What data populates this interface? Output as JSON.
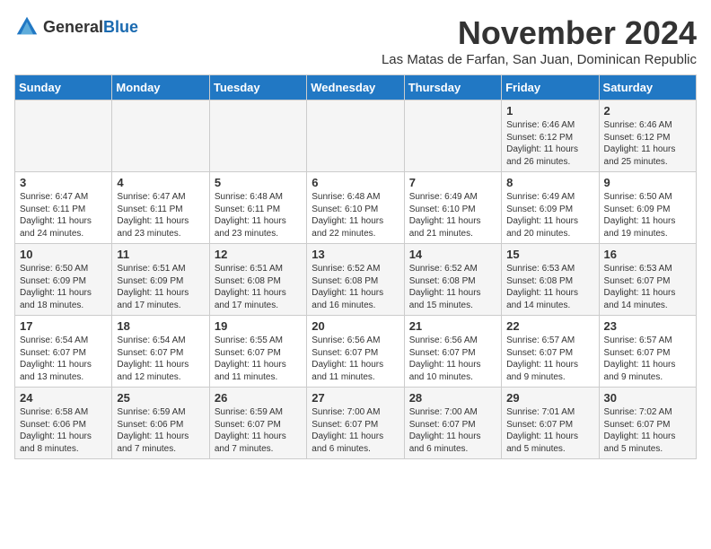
{
  "logo": {
    "general": "General",
    "blue": "Blue"
  },
  "title": "November 2024",
  "subtitle": "Las Matas de Farfan, San Juan, Dominican Republic",
  "days_of_week": [
    "Sunday",
    "Monday",
    "Tuesday",
    "Wednesday",
    "Thursday",
    "Friday",
    "Saturday"
  ],
  "weeks": [
    [
      {
        "day": "",
        "info": ""
      },
      {
        "day": "",
        "info": ""
      },
      {
        "day": "",
        "info": ""
      },
      {
        "day": "",
        "info": ""
      },
      {
        "day": "",
        "info": ""
      },
      {
        "day": "1",
        "info": "Sunrise: 6:46 AM\nSunset: 6:12 PM\nDaylight: 11 hours and 26 minutes."
      },
      {
        "day": "2",
        "info": "Sunrise: 6:46 AM\nSunset: 6:12 PM\nDaylight: 11 hours and 25 minutes."
      }
    ],
    [
      {
        "day": "3",
        "info": "Sunrise: 6:47 AM\nSunset: 6:11 PM\nDaylight: 11 hours and 24 minutes."
      },
      {
        "day": "4",
        "info": "Sunrise: 6:47 AM\nSunset: 6:11 PM\nDaylight: 11 hours and 23 minutes."
      },
      {
        "day": "5",
        "info": "Sunrise: 6:48 AM\nSunset: 6:11 PM\nDaylight: 11 hours and 23 minutes."
      },
      {
        "day": "6",
        "info": "Sunrise: 6:48 AM\nSunset: 6:10 PM\nDaylight: 11 hours and 22 minutes."
      },
      {
        "day": "7",
        "info": "Sunrise: 6:49 AM\nSunset: 6:10 PM\nDaylight: 11 hours and 21 minutes."
      },
      {
        "day": "8",
        "info": "Sunrise: 6:49 AM\nSunset: 6:09 PM\nDaylight: 11 hours and 20 minutes."
      },
      {
        "day": "9",
        "info": "Sunrise: 6:50 AM\nSunset: 6:09 PM\nDaylight: 11 hours and 19 minutes."
      }
    ],
    [
      {
        "day": "10",
        "info": "Sunrise: 6:50 AM\nSunset: 6:09 PM\nDaylight: 11 hours and 18 minutes."
      },
      {
        "day": "11",
        "info": "Sunrise: 6:51 AM\nSunset: 6:09 PM\nDaylight: 11 hours and 17 minutes."
      },
      {
        "day": "12",
        "info": "Sunrise: 6:51 AM\nSunset: 6:08 PM\nDaylight: 11 hours and 17 minutes."
      },
      {
        "day": "13",
        "info": "Sunrise: 6:52 AM\nSunset: 6:08 PM\nDaylight: 11 hours and 16 minutes."
      },
      {
        "day": "14",
        "info": "Sunrise: 6:52 AM\nSunset: 6:08 PM\nDaylight: 11 hours and 15 minutes."
      },
      {
        "day": "15",
        "info": "Sunrise: 6:53 AM\nSunset: 6:08 PM\nDaylight: 11 hours and 14 minutes."
      },
      {
        "day": "16",
        "info": "Sunrise: 6:53 AM\nSunset: 6:07 PM\nDaylight: 11 hours and 14 minutes."
      }
    ],
    [
      {
        "day": "17",
        "info": "Sunrise: 6:54 AM\nSunset: 6:07 PM\nDaylight: 11 hours and 13 minutes."
      },
      {
        "day": "18",
        "info": "Sunrise: 6:54 AM\nSunset: 6:07 PM\nDaylight: 11 hours and 12 minutes."
      },
      {
        "day": "19",
        "info": "Sunrise: 6:55 AM\nSunset: 6:07 PM\nDaylight: 11 hours and 11 minutes."
      },
      {
        "day": "20",
        "info": "Sunrise: 6:56 AM\nSunset: 6:07 PM\nDaylight: 11 hours and 11 minutes."
      },
      {
        "day": "21",
        "info": "Sunrise: 6:56 AM\nSunset: 6:07 PM\nDaylight: 11 hours and 10 minutes."
      },
      {
        "day": "22",
        "info": "Sunrise: 6:57 AM\nSunset: 6:07 PM\nDaylight: 11 hours and 9 minutes."
      },
      {
        "day": "23",
        "info": "Sunrise: 6:57 AM\nSunset: 6:07 PM\nDaylight: 11 hours and 9 minutes."
      }
    ],
    [
      {
        "day": "24",
        "info": "Sunrise: 6:58 AM\nSunset: 6:06 PM\nDaylight: 11 hours and 8 minutes."
      },
      {
        "day": "25",
        "info": "Sunrise: 6:59 AM\nSunset: 6:06 PM\nDaylight: 11 hours and 7 minutes."
      },
      {
        "day": "26",
        "info": "Sunrise: 6:59 AM\nSunset: 6:07 PM\nDaylight: 11 hours and 7 minutes."
      },
      {
        "day": "27",
        "info": "Sunrise: 7:00 AM\nSunset: 6:07 PM\nDaylight: 11 hours and 6 minutes."
      },
      {
        "day": "28",
        "info": "Sunrise: 7:00 AM\nSunset: 6:07 PM\nDaylight: 11 hours and 6 minutes."
      },
      {
        "day": "29",
        "info": "Sunrise: 7:01 AM\nSunset: 6:07 PM\nDaylight: 11 hours and 5 minutes."
      },
      {
        "day": "30",
        "info": "Sunrise: 7:02 AM\nSunset: 6:07 PM\nDaylight: 11 hours and 5 minutes."
      }
    ]
  ]
}
